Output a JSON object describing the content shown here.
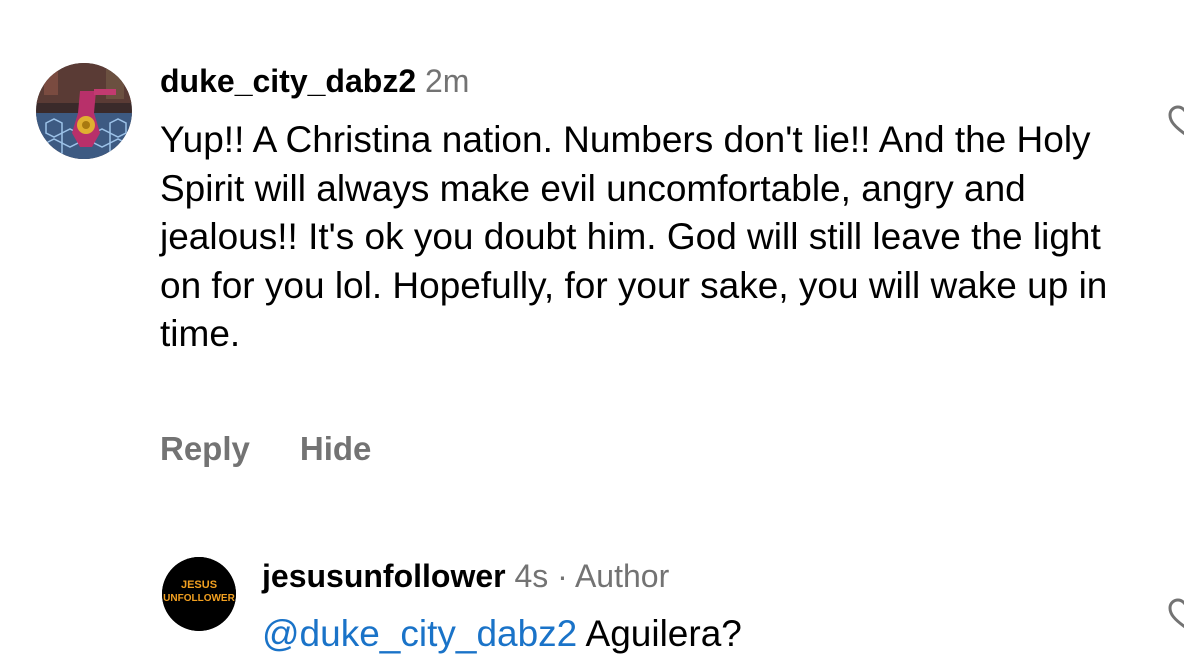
{
  "comment": {
    "username": "duke_city_dabz2",
    "time": "2m",
    "text": "Yup!! A Christina nation. Numbers don't lie!! And the Holy Spirit will always make evil uncomfortable, angry and jealous!! It's ok you doubt him. God will still leave the light on for you lol. Hopefully, for your sake, you will wake up in time.",
    "actions": {
      "reply": "Reply",
      "hide": "Hide"
    }
  },
  "reply": {
    "username": "jesusunfollower",
    "time": "4s",
    "separator": "·",
    "badge": "Author",
    "mention": "@duke_city_dabz2",
    "text": "Aguilera?",
    "avatar_text": {
      "line1": "JESUS",
      "line2": "UNFOLLOWER"
    }
  },
  "colors": {
    "secondary_text": "#737373",
    "mention": "#1a73c8",
    "avatar_reply_bg": "#000000",
    "avatar_reply_text": "#f2a020"
  },
  "icons": [
    "heart-icon"
  ]
}
